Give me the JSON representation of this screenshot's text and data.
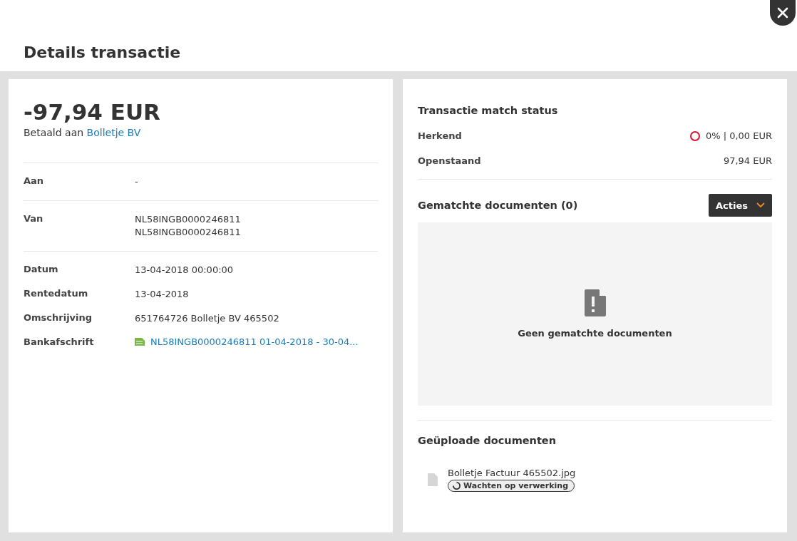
{
  "title": "Details transactie",
  "amount": "-97,94 EUR",
  "paid_to": {
    "prefix": "Betaald aan",
    "link": "Bolletje BV"
  },
  "detail_groups": [
    [
      {
        "label": "Aan",
        "kind": "text",
        "values": [
          "-"
        ]
      }
    ],
    [
      {
        "label": "Van",
        "kind": "text",
        "values": [
          "NL58INGB0000246811",
          "NL58INGB0000246811"
        ]
      }
    ],
    [
      {
        "label": "Datum",
        "kind": "text",
        "values": [
          "13-04-2018 00:00:00"
        ]
      },
      {
        "label": "Rentedatum",
        "kind": "text",
        "values": [
          "13-04-2018"
        ]
      },
      {
        "label": "Omschrijving",
        "kind": "text",
        "values": [
          "651764726 Bolletje BV 465502"
        ]
      },
      {
        "label": "Bankafschrift",
        "kind": "statement-link",
        "values": [
          "NL58INGB0000246811 01-04-2018 - 30-04..."
        ]
      }
    ]
  ],
  "match_status": {
    "title": "Transactie match status",
    "rows": [
      {
        "label": "Herkend",
        "value": "0% | 0,00 EUR",
        "color": "#e0112b"
      },
      {
        "label": "Openstaand",
        "value": "97,94 EUR"
      }
    ]
  },
  "matched": {
    "title": "Gematchte documenten (0)",
    "actions_button": "Acties",
    "empty_text": "Geen gematchte documenten"
  },
  "uploaded": {
    "title": "Geüploade documenten",
    "files": [
      {
        "name": "Bolletje Factuur 465502.jpg",
        "status": "Wachten op verwerking"
      }
    ]
  }
}
